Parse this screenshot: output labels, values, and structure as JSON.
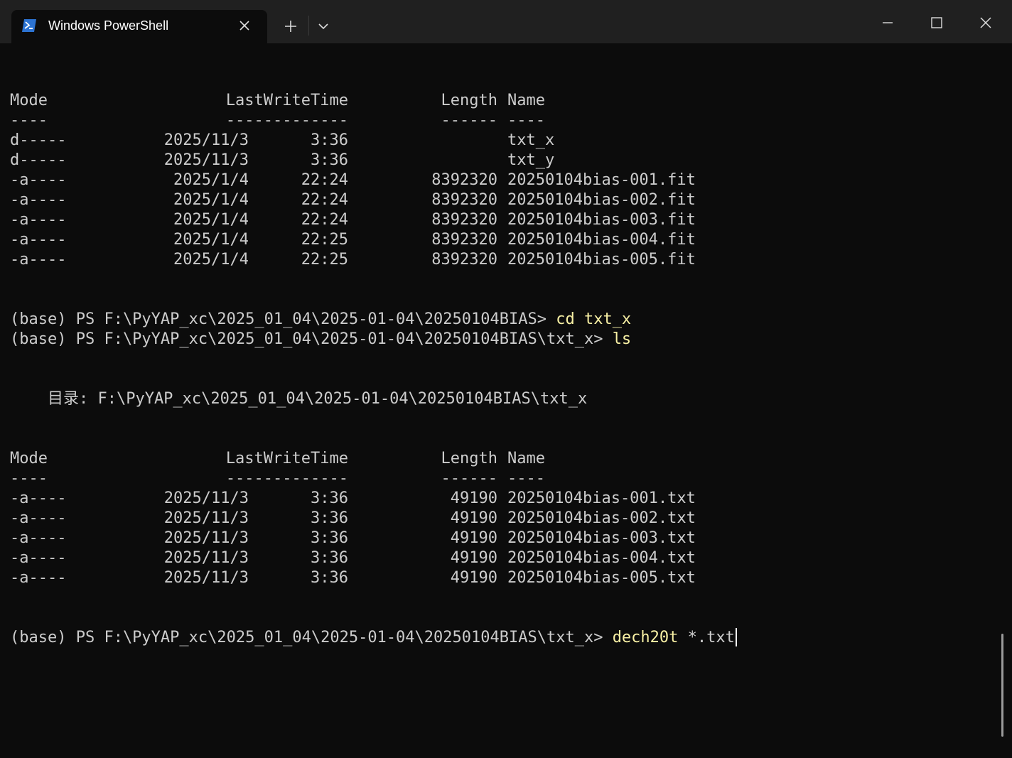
{
  "window": {
    "tab_title": "Windows PowerShell",
    "accent": "#2c73d2"
  },
  "icons": {
    "tab_icon": "powershell-icon",
    "tab_close": "close-icon",
    "new_tab": "plus-icon",
    "dropdown": "chevron-down-icon",
    "minimize": "minimize-icon",
    "maximize": "maximize-icon",
    "close": "close-icon"
  },
  "listing1": {
    "header": {
      "mode": "Mode",
      "time": "LastWriteTime",
      "length": "Length",
      "name": "Name"
    },
    "underline": {
      "mode": "----",
      "time": "-------------",
      "length": "------",
      "name": "----"
    },
    "rows": [
      {
        "mode": "d-----",
        "date": "2025/11/3",
        "time": "3:36",
        "length": "",
        "name": "txt_x"
      },
      {
        "mode": "d-----",
        "date": "2025/11/3",
        "time": "3:36",
        "length": "",
        "name": "txt_y"
      },
      {
        "mode": "-a----",
        "date": "2025/1/4",
        "time": "22:24",
        "length": "8392320",
        "name": "20250104bias-001.fit"
      },
      {
        "mode": "-a----",
        "date": "2025/1/4",
        "time": "22:24",
        "length": "8392320",
        "name": "20250104bias-002.fit"
      },
      {
        "mode": "-a----",
        "date": "2025/1/4",
        "time": "22:24",
        "length": "8392320",
        "name": "20250104bias-003.fit"
      },
      {
        "mode": "-a----",
        "date": "2025/1/4",
        "time": "22:25",
        "length": "8392320",
        "name": "20250104bias-004.fit"
      },
      {
        "mode": "-a----",
        "date": "2025/1/4",
        "time": "22:25",
        "length": "8392320",
        "name": "20250104bias-005.fit"
      }
    ]
  },
  "prompt1": {
    "prefix": "(base) PS F:\\PyYAP_xc\\2025_01_04\\2025-01-04\\20250104BIAS> ",
    "command": "cd txt_x"
  },
  "prompt2": {
    "prefix": "(base) PS F:\\PyYAP_xc\\2025_01_04\\2025-01-04\\20250104BIAS\\txt_x> ",
    "command": "ls"
  },
  "directory_line": "    目录: F:\\PyYAP_xc\\2025_01_04\\2025-01-04\\20250104BIAS\\txt_x",
  "listing2": {
    "header": {
      "mode": "Mode",
      "time": "LastWriteTime",
      "length": "Length",
      "name": "Name"
    },
    "underline": {
      "mode": "----",
      "time": "-------------",
      "length": "------",
      "name": "----"
    },
    "rows": [
      {
        "mode": "-a----",
        "date": "2025/11/3",
        "time": "3:36",
        "length": "49190",
        "name": "20250104bias-001.txt"
      },
      {
        "mode": "-a----",
        "date": "2025/11/3",
        "time": "3:36",
        "length": "49190",
        "name": "20250104bias-002.txt"
      },
      {
        "mode": "-a----",
        "date": "2025/11/3",
        "time": "3:36",
        "length": "49190",
        "name": "20250104bias-003.txt"
      },
      {
        "mode": "-a----",
        "date": "2025/11/3",
        "time": "3:36",
        "length": "49190",
        "name": "20250104bias-004.txt"
      },
      {
        "mode": "-a----",
        "date": "2025/11/3",
        "time": "3:36",
        "length": "49190",
        "name": "20250104bias-005.txt"
      }
    ]
  },
  "prompt3": {
    "prefix": "(base) PS F:\\PyYAP_xc\\2025_01_04\\2025-01-04\\20250104BIAS\\txt_x> ",
    "command": "dech20t",
    "args": " *.txt"
  }
}
